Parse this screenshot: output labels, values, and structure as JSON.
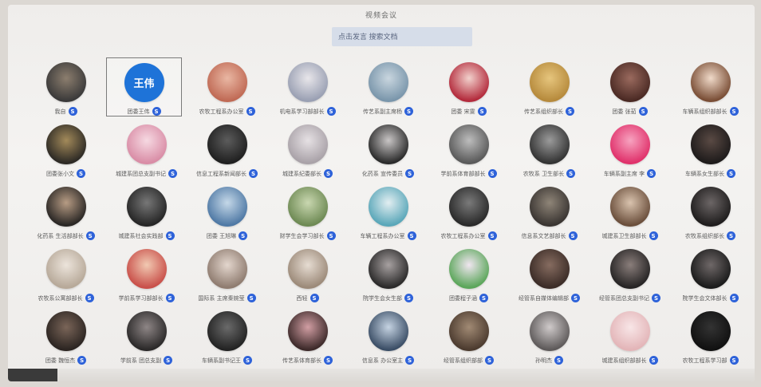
{
  "window": {
    "title": "视频会议"
  },
  "search": {
    "value": "点击发言 搜索文档"
  },
  "selected_index": 1,
  "participants": [
    {
      "name": "我自",
      "avatar_bg": [
        "#3b3a3a",
        "#8c7e6e"
      ],
      "avatar_text": ""
    },
    {
      "name": "团委王伟",
      "avatar_bg": [
        "#1e73d8",
        "#1e73d8"
      ],
      "avatar_text": "王伟"
    },
    {
      "name": "农牧工程系办公室",
      "avatar_bg": [
        "#c06a55",
        "#e9b7a3"
      ],
      "avatar_text": ""
    },
    {
      "name": "机电系学习部部长",
      "avatar_bg": [
        "#9aa0b3",
        "#e8e6ea"
      ],
      "avatar_text": ""
    },
    {
      "name": "传艺系副主席杨",
      "avatar_bg": [
        "#7a96ab",
        "#c9d6df"
      ],
      "avatar_text": ""
    },
    {
      "name": "团委 宋雯",
      "avatar_bg": [
        "#b32b3c",
        "#f2d1cc"
      ],
      "avatar_text": ""
    },
    {
      "name": "传艺系组织部长",
      "avatar_bg": [
        "#b68a3c",
        "#e6c57d"
      ],
      "avatar_text": ""
    },
    {
      "name": "团委 张茹",
      "avatar_bg": [
        "#4b2a24",
        "#9a6a5e"
      ],
      "avatar_text": ""
    },
    {
      "name": "车辆系组织部部长",
      "avatar_bg": [
        "#7a4e36",
        "#f0dac9"
      ],
      "avatar_text": ""
    },
    {
      "name": "团委张小文",
      "avatar_bg": [
        "#2d2a25",
        "#a38a5a"
      ],
      "avatar_text": ""
    },
    {
      "name": "城建系团总支副书记",
      "avatar_bg": [
        "#d98da6",
        "#f6d9e2"
      ],
      "avatar_text": ""
    },
    {
      "name": "信息工程系新闻部长",
      "avatar_bg": [
        "#202020",
        "#5c5c5c"
      ],
      "avatar_text": ""
    },
    {
      "name": "城建系纪委部长",
      "avatar_bg": [
        "#a9a2a8",
        "#e6e1e4"
      ],
      "avatar_text": ""
    },
    {
      "name": "化药系 宣传委员",
      "avatar_bg": [
        "#2b2b2b",
        "#c9c6c6"
      ],
      "avatar_text": ""
    },
    {
      "name": "学前系体育部部长",
      "avatar_bg": [
        "#5a5a5a",
        "#bdbdbd"
      ],
      "avatar_text": ""
    },
    {
      "name": "农牧系 卫生部长",
      "avatar_bg": [
        "#343434",
        "#9b9b9b"
      ],
      "avatar_text": ""
    },
    {
      "name": "车辆系副主席 李",
      "avatar_bg": [
        "#e0326b",
        "#f7a3c0"
      ],
      "avatar_text": ""
    },
    {
      "name": "车辆系女生部长",
      "avatar_bg": [
        "#1e1b1b",
        "#5a4a44"
      ],
      "avatar_text": ""
    },
    {
      "name": "化药系 生活部部长",
      "avatar_bg": [
        "#2a2725",
        "#b79c84"
      ],
      "avatar_text": ""
    },
    {
      "name": "城建系社会实践部",
      "avatar_bg": [
        "#262626",
        "#777777"
      ],
      "avatar_text": ""
    },
    {
      "name": "团委 王旭琳",
      "avatar_bg": [
        "#4f79a5",
        "#c5d8e8"
      ],
      "avatar_text": ""
    },
    {
      "name": "财学生会学习部长",
      "avatar_bg": [
        "#6e8a54",
        "#c9d7b0"
      ],
      "avatar_text": ""
    },
    {
      "name": "车辆工程系办公室",
      "avatar_bg": [
        "#5aa7b9",
        "#e2eef1"
      ],
      "avatar_text": ""
    },
    {
      "name": "农牧工程系办公室",
      "avatar_bg": [
        "#2a2a2a",
        "#7a7a7a"
      ],
      "avatar_text": ""
    },
    {
      "name": "信息系文艺部部长",
      "avatar_bg": [
        "#3a3532",
        "#8f8578"
      ],
      "avatar_text": ""
    },
    {
      "name": "城建系卫生部部长",
      "avatar_bg": [
        "#6b4f3c",
        "#d9c3ae"
      ],
      "avatar_text": ""
    },
    {
      "name": "农牧系组织部长",
      "avatar_bg": [
        "#1f1d1d",
        "#6c6666"
      ],
      "avatar_text": ""
    },
    {
      "name": "农牧系公寓部部长",
      "avatar_bg": [
        "#b7a999",
        "#ece4db"
      ],
      "avatar_text": ""
    },
    {
      "name": "学前系学习部部长",
      "avatar_bg": [
        "#c9504a",
        "#f1c9b2"
      ],
      "avatar_text": ""
    },
    {
      "name": "国际系 主席秦婉莹",
      "avatar_bg": [
        "#8f7c70",
        "#e3d6cd"
      ],
      "avatar_text": ""
    },
    {
      "name": "西轻",
      "avatar_bg": [
        "#9c8a79",
        "#e6dcd2"
      ],
      "avatar_text": ""
    },
    {
      "name": "院学生会女生部",
      "avatar_bg": [
        "#2b2a2a",
        "#a7a1a1"
      ],
      "avatar_text": ""
    },
    {
      "name": "团委程子涵",
      "avatar_bg": [
        "#5ba65a",
        "#f0e6f0"
      ],
      "avatar_text": ""
    },
    {
      "name": "经管系自媒体编辑部",
      "avatar_bg": [
        "#3b2c27",
        "#866c60"
      ],
      "avatar_text": ""
    },
    {
      "name": "经管系团总支副书记",
      "avatar_bg": [
        "#262424",
        "#8a7e7b"
      ],
      "avatar_text": ""
    },
    {
      "name": "院学生会文体部长",
      "avatar_bg": [
        "#1b1b1b",
        "#6f6868"
      ],
      "avatar_text": ""
    },
    {
      "name": "团委 魏恒杰",
      "avatar_bg": [
        "#2c2522",
        "#7a6558"
      ],
      "avatar_text": ""
    },
    {
      "name": "学前系 团总支副",
      "avatar_bg": [
        "#2b2929",
        "#8e8686"
      ],
      "avatar_text": ""
    },
    {
      "name": "车辆系副书记王",
      "avatar_bg": [
        "#232323",
        "#6a6a6a"
      ],
      "avatar_text": ""
    },
    {
      "name": "传艺系体育部长",
      "avatar_bg": [
        "#3d2a2a",
        "#d19ea3"
      ],
      "avatar_text": ""
    },
    {
      "name": "信息系 办公室主",
      "avatar_bg": [
        "#3b4e66",
        "#c5d3e2"
      ],
      "avatar_text": ""
    },
    {
      "name": "经管系组织部部",
      "avatar_bg": [
        "#4c3b2f",
        "#a18a74"
      ],
      "avatar_text": ""
    },
    {
      "name": "孙明杰",
      "avatar_bg": [
        "#5e5a5a",
        "#cfcaca"
      ],
      "avatar_text": ""
    },
    {
      "name": "城建系组织部部长",
      "avatar_bg": [
        "#e3b5b8",
        "#f8e6e7"
      ],
      "avatar_text": ""
    },
    {
      "name": "农牧工程系学习部",
      "avatar_bg": [
        "#111111",
        "#333333"
      ],
      "avatar_text": ""
    }
  ]
}
